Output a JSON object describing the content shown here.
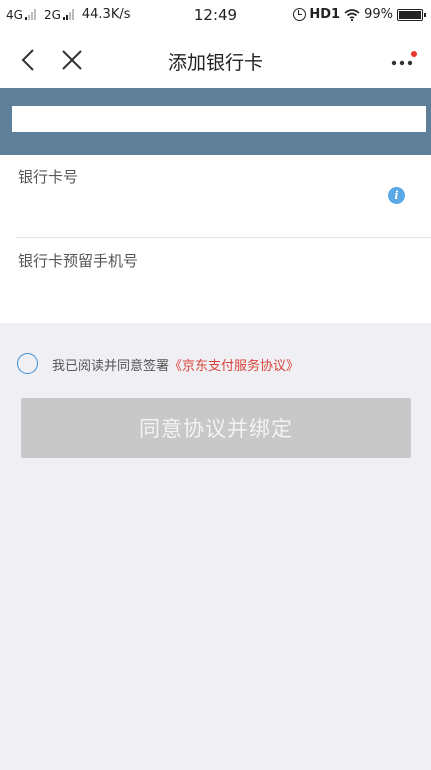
{
  "status_bar": {
    "signal1": "4G",
    "signal2": "2G",
    "speed": "44.3K/s",
    "time": "12:49",
    "hd": "HD1",
    "battery": "99%"
  },
  "nav": {
    "title": "添加银行卡",
    "icons": {
      "back": "chevron-left-icon",
      "close": "close-icon",
      "more": "more-dots-icon"
    },
    "notification_dot_color": "#e5372b"
  },
  "card_band": {
    "color": "#5f7f98",
    "name_value": ""
  },
  "form": {
    "card_number": {
      "label": "银行卡号",
      "value": ""
    },
    "phone": {
      "label": "银行卡预留手机号",
      "value": ""
    }
  },
  "agreement": {
    "prefix": "我已阅读并同意签署",
    "link": "《京东支付服务协议》",
    "link_color": "#d9453b"
  },
  "bind_button": {
    "label": "同意协议并绑定",
    "state": "disabled"
  }
}
